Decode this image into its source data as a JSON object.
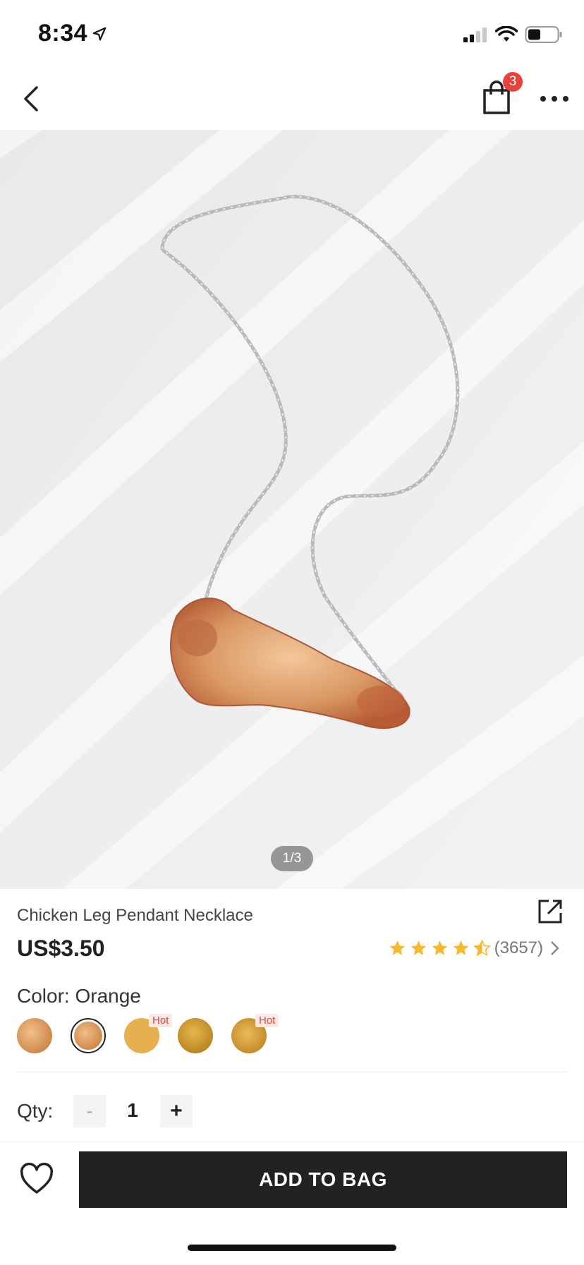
{
  "status": {
    "time": "8:34"
  },
  "header": {
    "cart_count": "3"
  },
  "gallery": {
    "pager": "1/3"
  },
  "product": {
    "title": "Chicken Leg Pendant Necklace",
    "price": "US$3.50",
    "rating": {
      "stars": 4.5,
      "count": "(3657)"
    },
    "color_label": "Color: Orange",
    "swatches": [
      {
        "color": "#d89a5c",
        "selected": false,
        "hot": ""
      },
      {
        "color": "#d9955a",
        "selected": true,
        "hot": ""
      },
      {
        "color": "#e6b04e",
        "selected": false,
        "hot": "Hot"
      },
      {
        "color": "#c9962e",
        "selected": false,
        "hot": ""
      },
      {
        "color": "#d8a23a",
        "selected": false,
        "hot": "Hot"
      }
    ],
    "qty_label": "Qty:",
    "qty_minus": "-",
    "qty_value": "1",
    "qty_plus": "+"
  },
  "actions": {
    "add_to_bag": "ADD TO BAG"
  },
  "colors": {
    "badge": "#e8423a",
    "star": "#f5b82e",
    "button": "#222222"
  }
}
